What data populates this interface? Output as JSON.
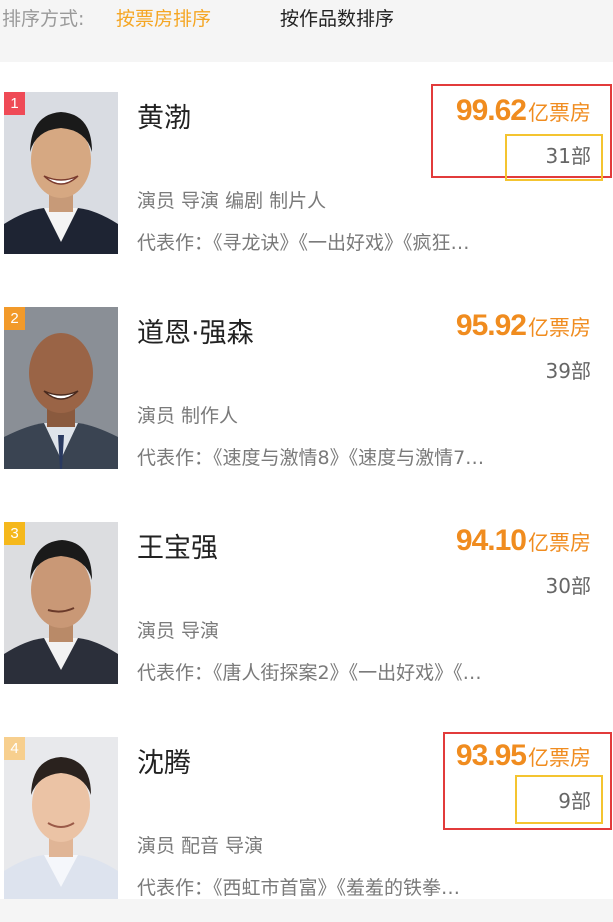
{
  "sort": {
    "label": "排序方式:",
    "active": "按票房排序",
    "other": "按作品数排序"
  },
  "colors": {
    "accent": "#f5a623",
    "box_office": "#f08c1f",
    "rank_1": "#ef4a56",
    "rank_2": "#f29a2a",
    "rank_3": "#f5b81c",
    "rank_4": "#f7cf8e",
    "highlight_red": "#e23b3b",
    "highlight_yellow": "#f4c430"
  },
  "actors": [
    {
      "rank": "1",
      "name": "黄渤",
      "box_office": "99.62",
      "unit": "亿票房",
      "count": "31部",
      "roles": "演员 导演 编剧 制片人",
      "works": "代表作：《寻龙诀》《一出好戏》《疯狂…"
    },
    {
      "rank": "2",
      "name": "道恩·强森",
      "box_office": "95.92",
      "unit": "亿票房",
      "count": "39部",
      "roles": "演员 制作人",
      "works": "代表作：《速度与激情8》《速度与激情7…"
    },
    {
      "rank": "3",
      "name": "王宝强",
      "box_office": "94.10",
      "unit": "亿票房",
      "count": "30部",
      "roles": "演员 导演",
      "works": "代表作：《唐人街探案2》《一出好戏》《…"
    },
    {
      "rank": "4",
      "name": "沈腾",
      "box_office": "93.95",
      "unit": "亿票房",
      "count": "9部",
      "roles": "演员 配音 导演",
      "works": "代表作：《西虹市首富》《羞羞的铁拳…"
    }
  ]
}
